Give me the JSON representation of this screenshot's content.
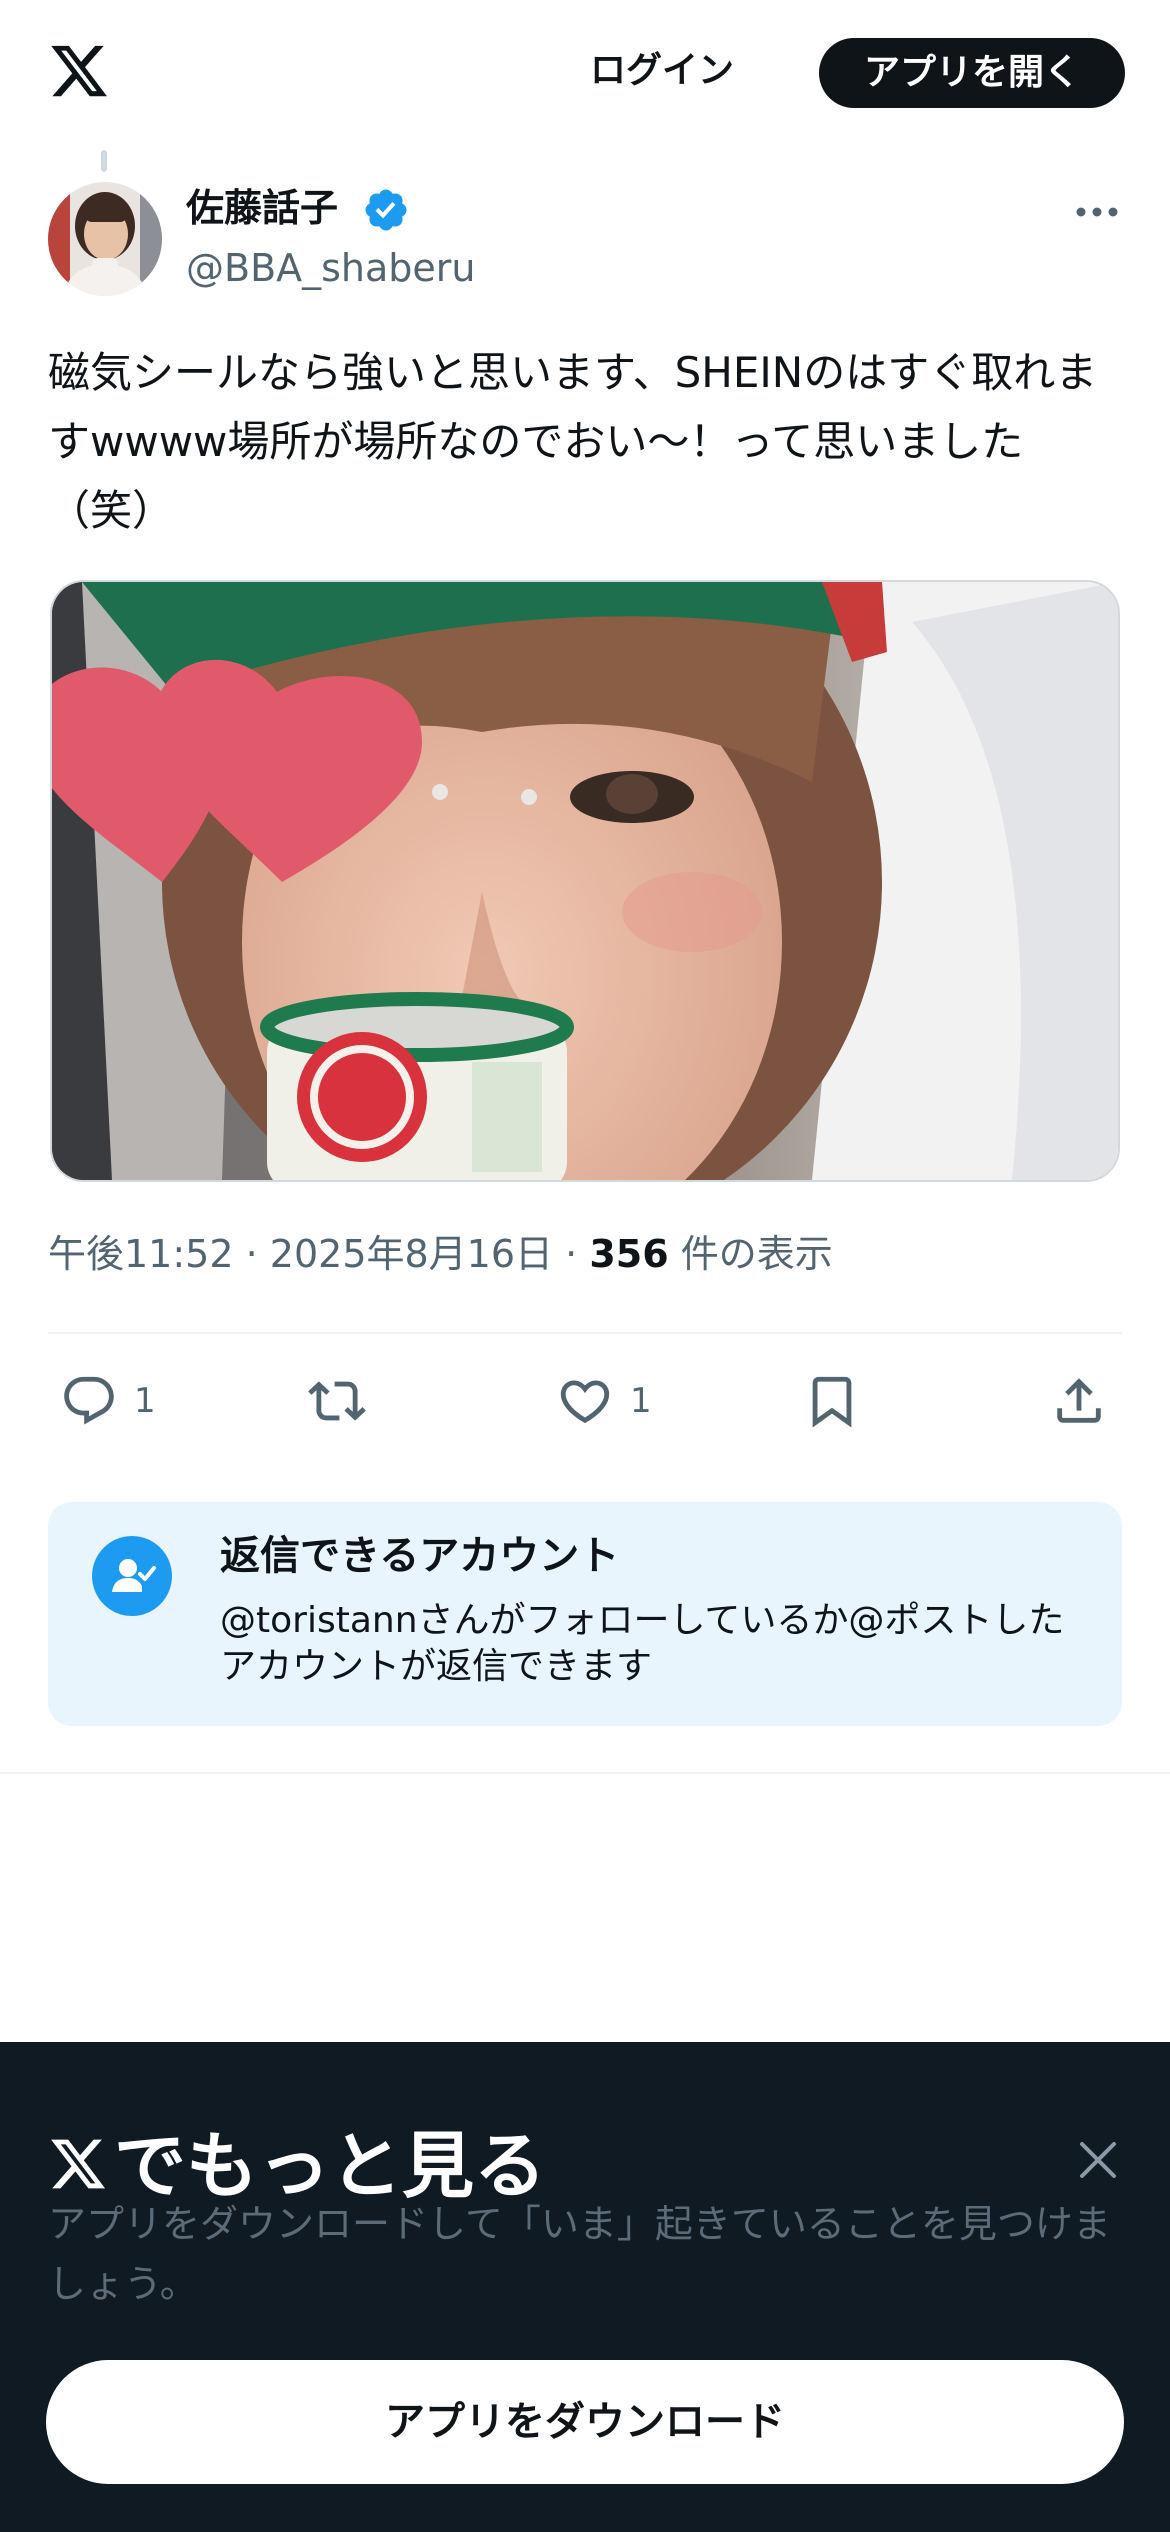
{
  "header": {
    "logo_icon": "x-logo-icon",
    "login_label": "ログイン",
    "open_app_label": "アプリを開く"
  },
  "post": {
    "author_name": "佐藤話子",
    "author_handle": "@BBA_shaberu",
    "verified": true,
    "text": "磁気シールなら強いと思います、SHEINのはすぐ取れますwwww場所が場所なのでおい〜！って思いました（笑）",
    "time": "午後11:52",
    "date": "2025年8月16日",
    "separator": "·",
    "views_count": "356",
    "views_label": "件の表示"
  },
  "actions": {
    "reply_count": "1",
    "like_count": "1"
  },
  "reply_restriction": {
    "title": "返信できるアカウント",
    "description": "@toristannさんがフォローしているか@ポストしたアカウントが返信できます"
  },
  "bottom_sheet": {
    "title": "でもっと見る",
    "description": "アプリをダウンロードして「いま」起きていることを見つけましょう。",
    "download_label": "アプリをダウンロード"
  },
  "colors": {
    "primary_text": "#0f1419",
    "secondary_text": "#536471",
    "verified_blue": "#1d9bf0",
    "sheet_background": "#101a23",
    "reply_card_background": "#e8f5fd"
  }
}
